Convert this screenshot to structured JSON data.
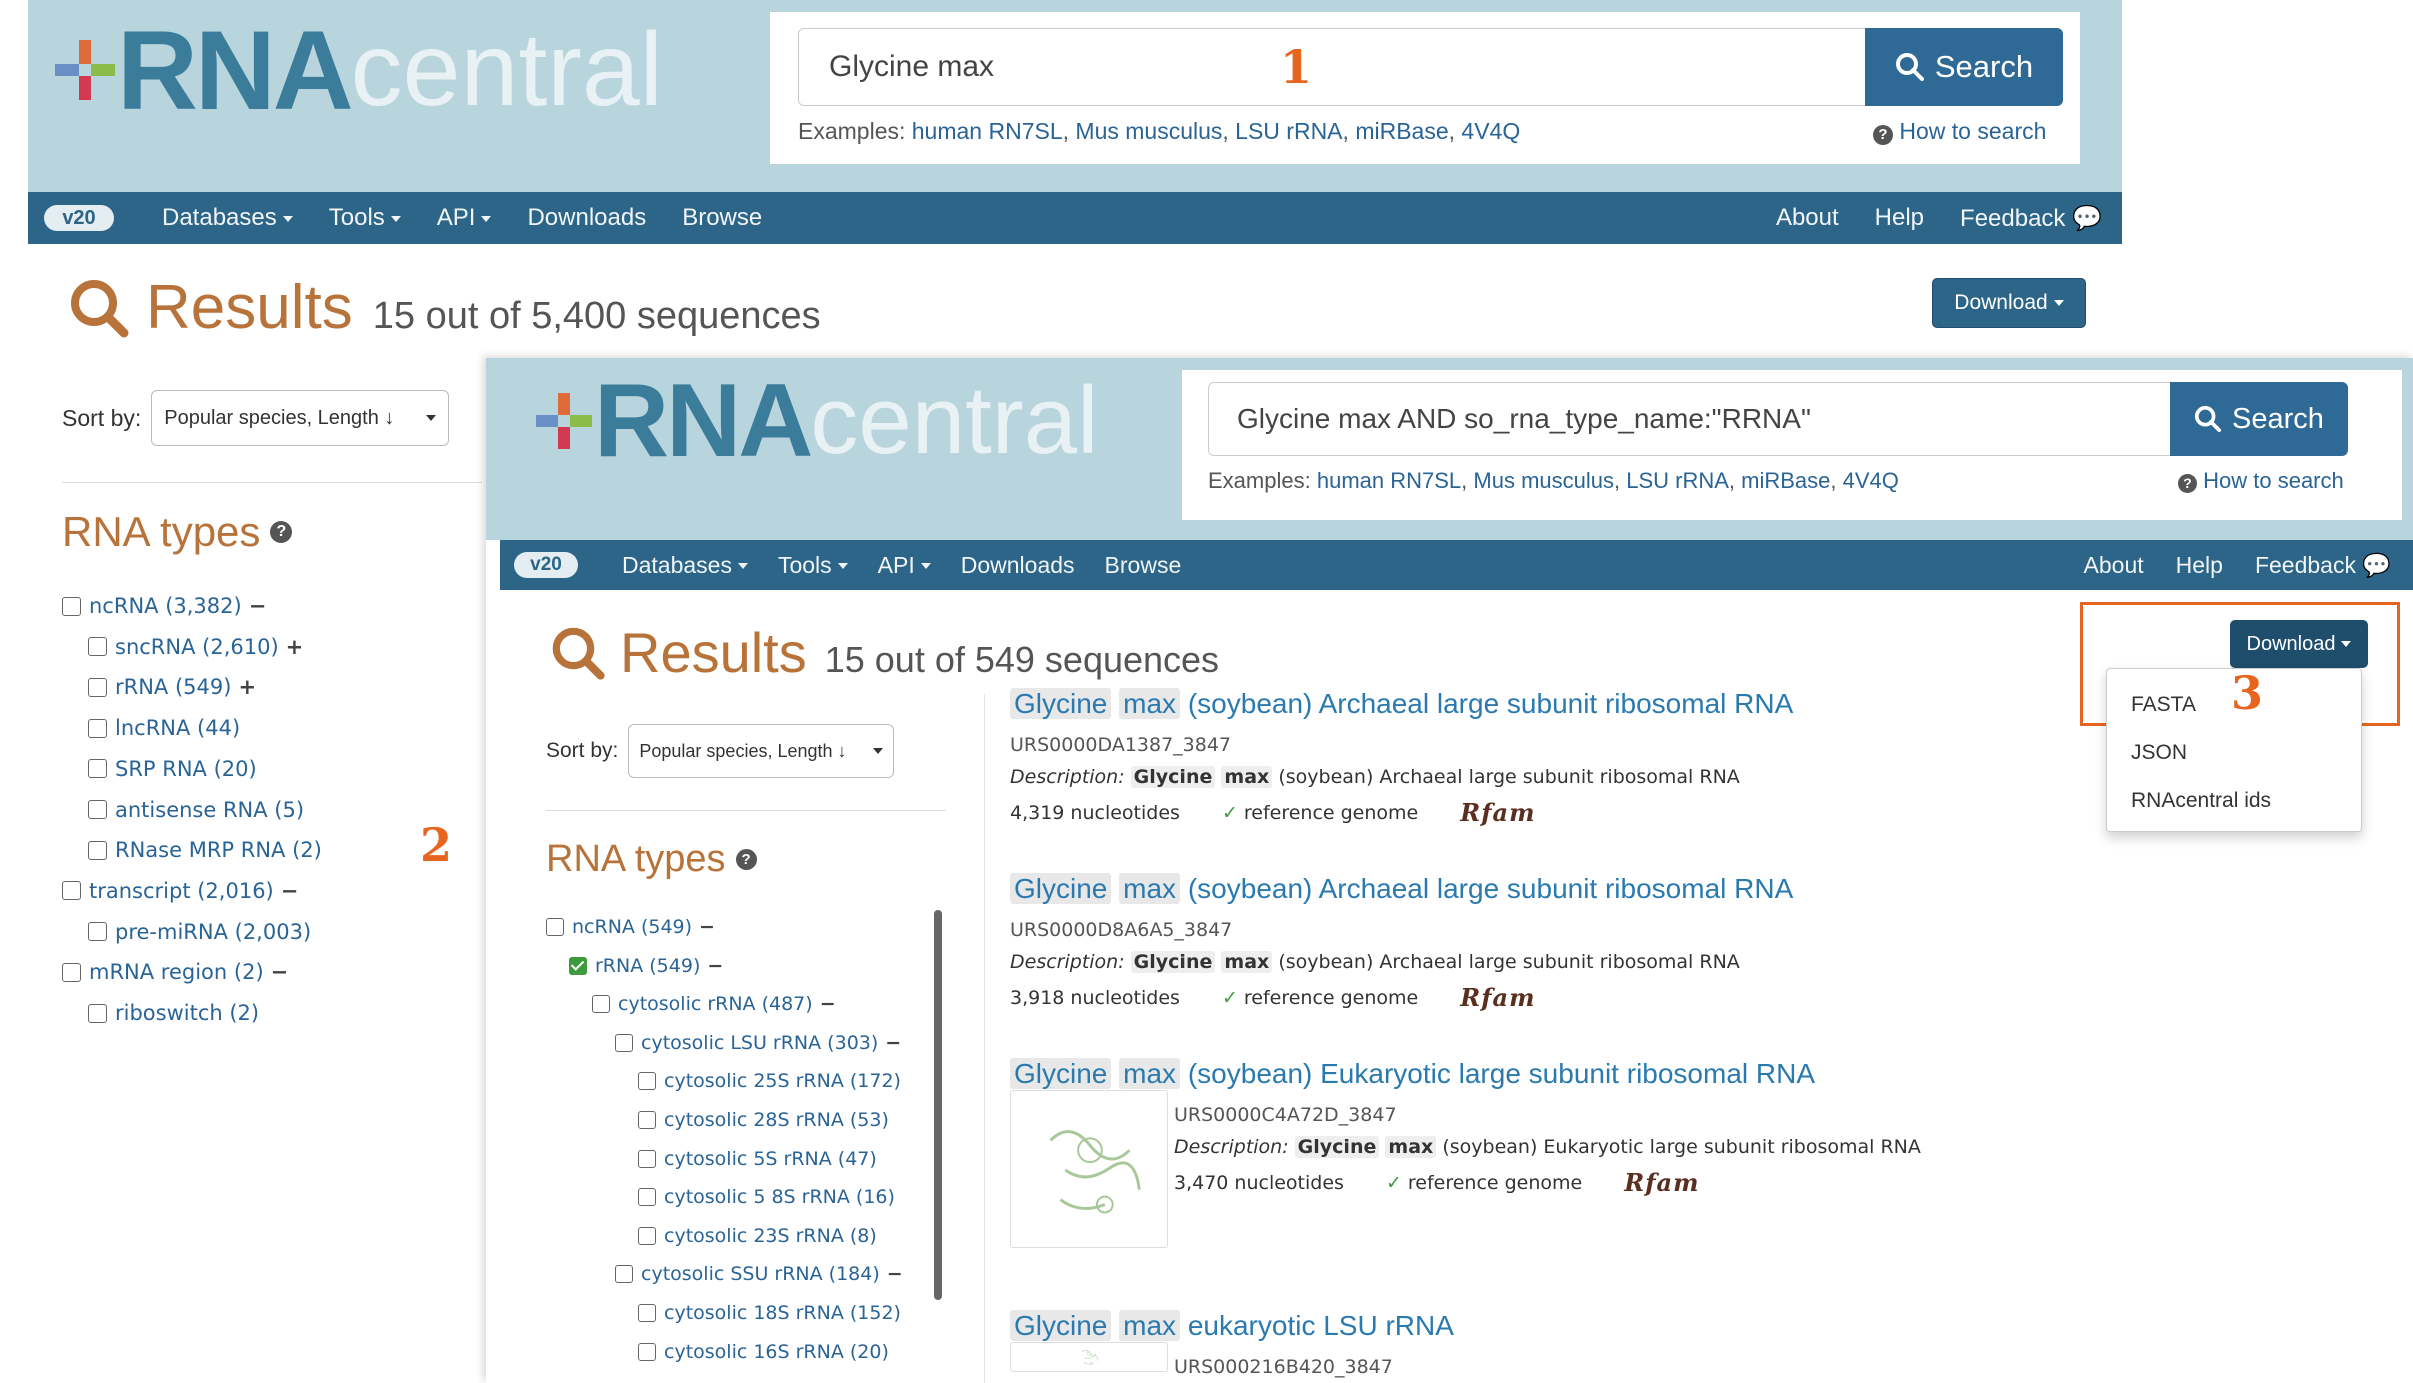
{
  "back": {
    "logo": {
      "rna": "RNA",
      "central": "central"
    },
    "search": {
      "value": "Glycine max",
      "button": "Search"
    },
    "examples": {
      "prefix": "Examples:",
      "links": [
        "human RN7SL",
        "Mus musculus",
        "LSU rRNA",
        "miRBase",
        "4V4Q"
      ]
    },
    "howto": "How to search",
    "nav": {
      "version": "v20",
      "left": [
        "Databases",
        "Tools",
        "API",
        "Downloads",
        "Browse"
      ],
      "right": [
        "About",
        "Help",
        "Feedback"
      ]
    },
    "results": {
      "word": "Results",
      "count": "15 out of 5,400 sequences"
    },
    "download": "Download",
    "sort": {
      "label": "Sort by:",
      "value": "Popular species, Length ↓"
    },
    "types_title": "RNA types",
    "facets": [
      {
        "label": "ncRNA (3,382)",
        "toggle": "−"
      },
      {
        "label": "sncRNA (2,610)",
        "toggle": "+"
      },
      {
        "label": "rRNA (549)",
        "toggle": "+"
      },
      {
        "label": "lncRNA (44)",
        "toggle": ""
      },
      {
        "label": "SRP RNA (20)",
        "toggle": ""
      },
      {
        "label": "antisense RNA (5)",
        "toggle": ""
      },
      {
        "label": "RNase MRP RNA (2)",
        "toggle": ""
      },
      {
        "label": "transcript (2,016)",
        "toggle": "−"
      },
      {
        "label": "pre-miRNA (2,003)",
        "toggle": ""
      },
      {
        "label": "mRNA region (2)",
        "toggle": "−"
      },
      {
        "label": "riboswitch (2)",
        "toggle": ""
      }
    ]
  },
  "markers": [
    "1",
    "2",
    "3"
  ],
  "front": {
    "logo": {
      "rna": "RNA",
      "central": "central"
    },
    "search": {
      "value": "Glycine max AND so_rna_type_name:\"RRNA\"",
      "button": "Search"
    },
    "examples": {
      "prefix": "Examples:",
      "links": [
        "human RN7SL",
        "Mus musculus",
        "LSU rRNA",
        "miRBase",
        "4V4Q"
      ]
    },
    "howto": "How to search",
    "nav": {
      "version": "v20",
      "left": [
        "Databases",
        "Tools",
        "API",
        "Downloads",
        "Browse"
      ],
      "right": [
        "About",
        "Help",
        "Feedback"
      ]
    },
    "results": {
      "word": "Results",
      "count": "15 out of 549 sequences"
    },
    "download": "Download",
    "download_menu": [
      "FASTA",
      "JSON",
      "RNAcentral ids"
    ],
    "sort": {
      "label": "Sort by:",
      "value": "Popular species, Length ↓"
    },
    "types_title": "RNA types",
    "facets": [
      {
        "label": "ncRNA (549)",
        "toggle": "−",
        "checked": false
      },
      {
        "label": "rRNA (549)",
        "toggle": "−",
        "checked": true
      },
      {
        "label": "cytosolic rRNA (487)",
        "toggle": "−",
        "checked": false
      },
      {
        "label": "cytosolic LSU rRNA (303)",
        "toggle": "−",
        "checked": false
      },
      {
        "label": "cytosolic 25S rRNA (172)",
        "toggle": "",
        "checked": false
      },
      {
        "label": "cytosolic 28S rRNA (53)",
        "toggle": "",
        "checked": false
      },
      {
        "label": "cytosolic 5S rRNA (47)",
        "toggle": "",
        "checked": false
      },
      {
        "label": "cytosolic 5 8S rRNA (16)",
        "toggle": "",
        "checked": false
      },
      {
        "label": "cytosolic 23S rRNA (8)",
        "toggle": "",
        "checked": false
      },
      {
        "label": "cytosolic SSU rRNA (184)",
        "toggle": "−",
        "checked": false
      },
      {
        "label": "cytosolic 18S rRNA (152)",
        "toggle": "",
        "checked": false
      },
      {
        "label": "cytosolic 16S rRNA (20)",
        "toggle": "",
        "checked": false
      }
    ],
    "results_list": [
      {
        "w1": "Glycine",
        "w2": "max",
        "rest": "(soybean) Archaeal large subunit ribosomal RNA",
        "id": "URS0000DA1387_3847",
        "desc_label": "Description:",
        "desc_rest": "(soybean) Archaeal large subunit ribosomal RNA",
        "length": "4,319 nucleotides",
        "ref": "reference genome",
        "db": "Rfam"
      },
      {
        "w1": "Glycine",
        "w2": "max",
        "rest": "(soybean) Archaeal large subunit ribosomal RNA",
        "id": "URS0000D8A6A5_3847",
        "desc_label": "Description:",
        "desc_rest": "(soybean) Archaeal large subunit ribosomal RNA",
        "length": "3,918 nucleotides",
        "ref": "reference genome",
        "db": "Rfam"
      },
      {
        "w1": "Glycine",
        "w2": "max",
        "rest": "(soybean) Eukaryotic large subunit ribosomal RNA",
        "id": "URS0000C4A72D_3847",
        "desc_label": "Description:",
        "desc_rest": "(soybean) Eukaryotic large subunit ribosomal RNA",
        "length": "3,470 nucleotides",
        "ref": "reference genome",
        "db": "Rfam"
      },
      {
        "w1": "Glycine",
        "w2": "max",
        "rest": "eukaryotic LSU rRNA",
        "id": "URS000216B420_3847"
      }
    ]
  }
}
